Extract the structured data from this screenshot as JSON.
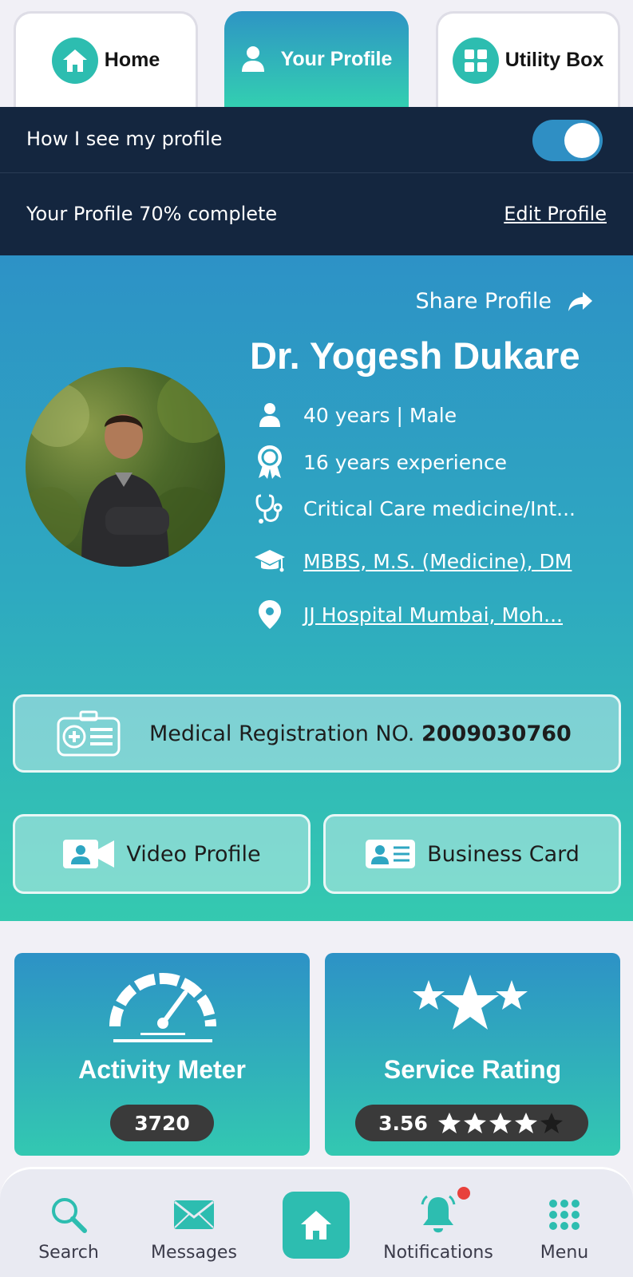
{
  "tabs": [
    {
      "label": "Home",
      "icon": "home-icon"
    },
    {
      "label": "Your Profile",
      "icon": "user-icon"
    },
    {
      "label": "Utility Box",
      "icon": "grid-icon"
    }
  ],
  "header": {
    "view_toggle_label": "How I see my profile",
    "view_toggle_on": true,
    "completion_text": "Your Profile 70% complete",
    "completion_percent": 70,
    "edit_profile_label": "Edit Profile"
  },
  "profile": {
    "share_label": "Share Profile",
    "name": "Dr. Yogesh Dukare",
    "age_gender": "40 years | Male",
    "experience": "16 years experience",
    "specialty": "Critical Care medicine/Int...",
    "qualifications": "MBBS, M.S. (Medicine), DM",
    "location": "JJ Hospital Mumbai, Moh...",
    "registration_label": "Medical Registration NO.",
    "registration_number": "2009030760",
    "video_profile_label": "Video Profile",
    "business_card_label": "Business Card"
  },
  "stats": {
    "activity": {
      "title": "Activity Meter",
      "value": "3720"
    },
    "rating": {
      "title": "Service Rating",
      "value": "3.56",
      "stars_filled": 4,
      "stars_total": 5
    }
  },
  "bottom_nav": {
    "items": [
      {
        "label": "Search",
        "icon": "search-icon"
      },
      {
        "label": "Messages",
        "icon": "envelope-icon"
      },
      {
        "label": "",
        "icon": "home-icon"
      },
      {
        "label": "Notifications",
        "icon": "bell-icon"
      },
      {
        "label": "Menu",
        "icon": "grid-dots-icon"
      }
    ]
  },
  "colors": {
    "teal": "#2dbdb0",
    "blue": "#2d92c6",
    "dark_navy": "#14263f",
    "notification_dot": "#e8413c"
  }
}
